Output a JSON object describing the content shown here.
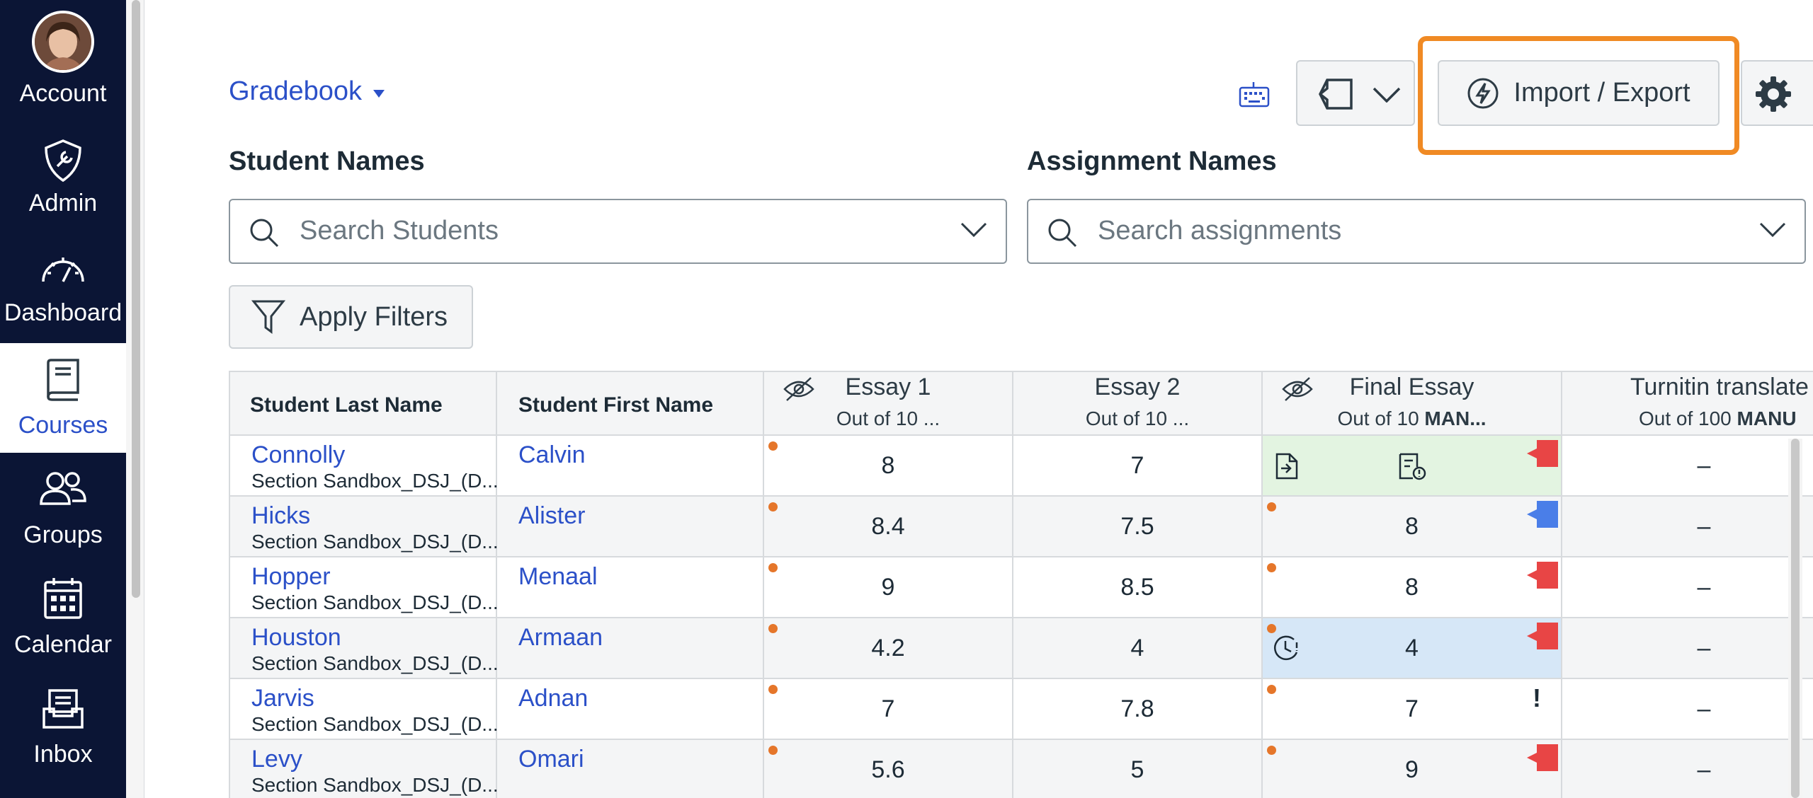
{
  "nav": {
    "account": "Account",
    "admin": "Admin",
    "dashboard": "Dashboard",
    "courses": "Courses",
    "groups": "Groups",
    "calendar": "Calendar",
    "inbox": "Inbox",
    "active": "Courses"
  },
  "toolbar": {
    "gradebook_label": "Gradebook",
    "import_export_label": "Import / Export"
  },
  "filters": {
    "student_names_label": "Student Names",
    "student_search_placeholder": "Search Students",
    "assignment_names_label": "Assignment Names",
    "assignment_search_placeholder": "Search assignments",
    "apply_filters_label": "Apply Filters"
  },
  "grid": {
    "headers": {
      "last_name": "Student Last Name",
      "first_name": "Student First Name",
      "essay1_title": "Essay 1",
      "essay1_sub": "Out of 10 ...",
      "essay2_title": "Essay 2",
      "essay2_sub": "Out of 10 ...",
      "final_title": "Final Essay",
      "final_sub_prefix": "Out of 10 ",
      "final_sub_bold": "MAN...",
      "turnitin_title": "Turnitin translate",
      "turnitin_sub_prefix": "Out of 100 ",
      "turnitin_sub_bold": "MANU"
    },
    "rows": [
      {
        "last": "Connolly",
        "section": "Section Sandbox_DSJ_(D...",
        "first": "Calvin",
        "essay1": "8",
        "essay2": "7",
        "final": "",
        "turnitin": "–"
      },
      {
        "last": "Hicks",
        "section": "Section Sandbox_DSJ_(D...",
        "first": "Alister",
        "essay1": "8.4",
        "essay2": "7.5",
        "final": "8",
        "turnitin": "–"
      },
      {
        "last": "Hopper",
        "section": "Section Sandbox_DSJ_(D...",
        "first": "Menaal",
        "essay1": "9",
        "essay2": "8.5",
        "final": "8",
        "turnitin": "–"
      },
      {
        "last": "Houston",
        "section": "Section Sandbox_DSJ_(D...",
        "first": "Armaan",
        "essay1": "4.2",
        "essay2": "4",
        "final": "4",
        "turnitin": "–"
      },
      {
        "last": "Jarvis",
        "section": "Section Sandbox_DSJ_(D...",
        "first": "Adnan",
        "essay1": "7",
        "essay2": "7.8",
        "final": "7",
        "turnitin": "–"
      },
      {
        "last": "Levy",
        "section": "Section Sandbox_DSJ_(D...",
        "first": "Omari",
        "essay1": "5.6",
        "essay2": "5",
        "final": "9",
        "turnitin": "–"
      }
    ],
    "final_excused_mark": "!"
  },
  "colors": {
    "nav_bg": "#0b1535",
    "link": "#2b50c8",
    "highlight": "#f08a24",
    "flag_red": "#e84545",
    "flag_blue": "#4a7ee8",
    "submitted_bg": "#e3f4e1",
    "late_bg": "#d6e7f7",
    "unposted_dot": "#e5762a"
  },
  "icons": {
    "account": "avatar-photo",
    "admin": "shield-wrench-icon",
    "dashboard": "speedometer-icon",
    "courses": "book-icon",
    "groups": "people-icon",
    "calendar": "calendar-icon",
    "inbox": "inbox-tray-icon",
    "keyboard": "keyboard-icon",
    "view": "view-options-icon",
    "import_export": "lightning-icon",
    "settings": "gear-icon",
    "search": "search-icon",
    "filter": "funnel-icon",
    "hidden": "eye-slash-icon"
  }
}
